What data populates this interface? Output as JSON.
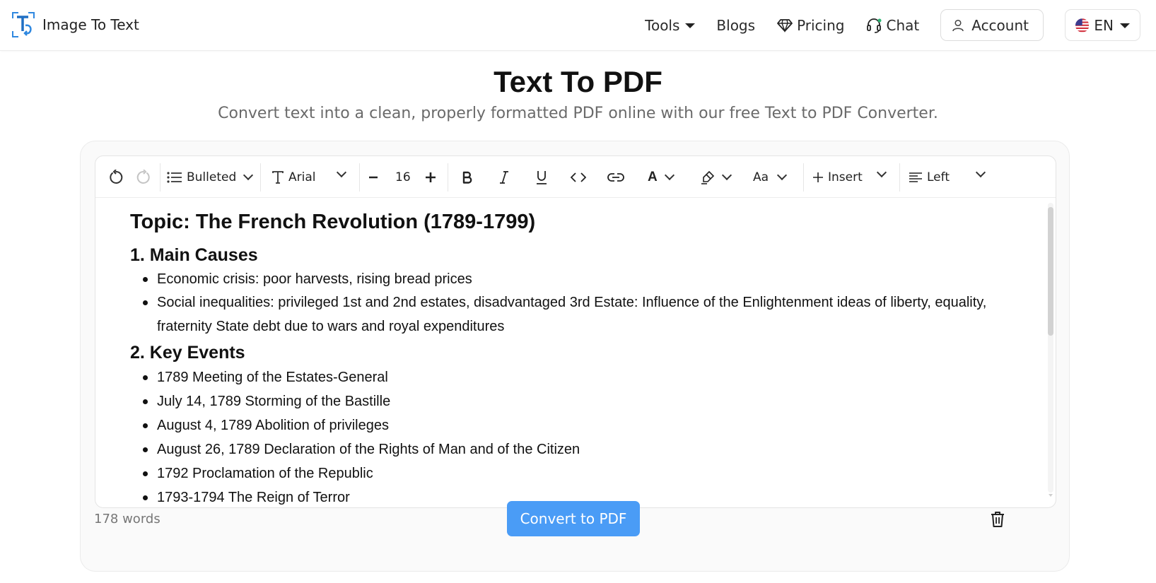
{
  "header": {
    "logo_text": "Image To Text",
    "nav": {
      "tools": "Tools",
      "blogs": "Blogs",
      "pricing": "Pricing",
      "chat": "Chat",
      "account": "Account",
      "language": "EN"
    }
  },
  "page": {
    "title": "Text To PDF",
    "subtitle": "Convert text into a clean, properly formatted PDF online with our free Text to PDF Converter."
  },
  "toolbar": {
    "list_style": "Bulleted",
    "font": "Arial",
    "font_size": "16",
    "case_label": "Aa",
    "insert": "Insert",
    "align": "Left",
    "text_color_label": "A"
  },
  "document": {
    "heading": "Topic: The French Revolution (1789-1799)",
    "sections": [
      {
        "title": "1. Main Causes",
        "items": [
          "Economic crisis: poor harvests, rising bread prices",
          "Social inequalities: privileged 1st and 2nd estates, disadvantaged 3rd Estate: Influence of the Enlightenment ideas of liberty, equality, fraternity State debt due to wars and royal expenditures"
        ]
      },
      {
        "title": "2. Key Events",
        "items": [
          "1789 Meeting of the Estates-General",
          "July 14, 1789 Storming of the Bastille",
          "August 4, 1789 Abolition of privileges",
          "August 26, 1789 Declaration of the Rights of Man and of the Citizen",
          "1792 Proclamation of the Republic",
          "1793-1794 The Reign of Terror"
        ]
      }
    ]
  },
  "footer": {
    "word_count": "178 words",
    "convert_label": "Convert to PDF"
  },
  "colors": {
    "accent": "#4a9cf6",
    "logo_blue": "#2f88e0"
  },
  "icons": [
    "logo-icon",
    "pricing-diamond-icon",
    "chat-headset-icon",
    "user-icon",
    "us-flag-icon",
    "undo-icon",
    "redo-icon",
    "list-icon",
    "font-icon",
    "minus-icon",
    "plus-icon",
    "bold-icon",
    "italic-icon",
    "underline-icon",
    "code-icon",
    "link-icon",
    "text-color-icon",
    "highlight-icon",
    "insert-plus-icon",
    "align-left-icon",
    "trash-icon"
  ]
}
